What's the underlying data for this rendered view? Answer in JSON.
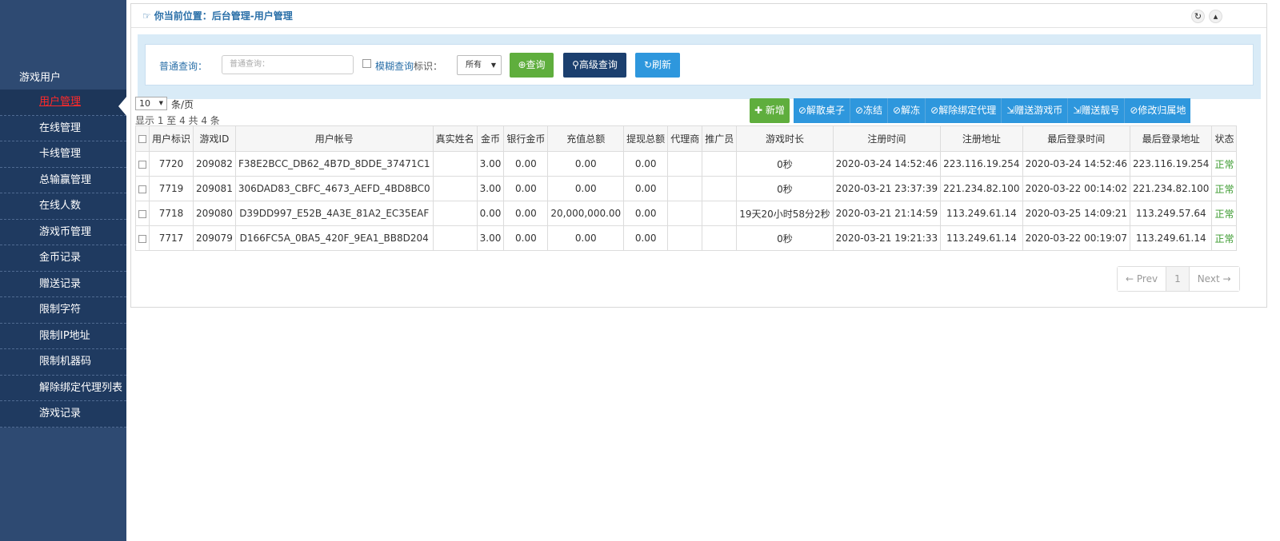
{
  "sidebar": {
    "group_title": "游戏用户",
    "items": [
      {
        "label": "用户管理",
        "active": true
      },
      {
        "label": "在线管理"
      },
      {
        "label": "卡线管理"
      },
      {
        "label": "总输赢管理"
      },
      {
        "label": "在线人数"
      },
      {
        "label": "游戏币管理"
      },
      {
        "label": "金币记录"
      },
      {
        "label": "赠送记录"
      },
      {
        "label": "限制字符"
      },
      {
        "label": "限制IP地址"
      },
      {
        "label": "限制机器码"
      },
      {
        "label": "解除绑定代理列表"
      },
      {
        "label": "游戏记录"
      }
    ]
  },
  "breadcrumb": "你当前位置：后台管理-用户管理",
  "search": {
    "label": "普通查询：",
    "placeholder": "普通查询：",
    "fuzzy_label": "模糊查询",
    "tag_label": "标识：",
    "tag_value": "所有",
    "query_btn": "查询",
    "advanced_btn": "高级查询",
    "refresh_btn": "刷新"
  },
  "pagination": {
    "per_page": "10",
    "per_page_suffix": "条/页",
    "showing": "显示 1 至 4 共 4 条",
    "prev": "← Prev",
    "page": "1",
    "next": "Next →"
  },
  "toolbar": {
    "add": "新增",
    "dismiss_table": "解散桌子",
    "freeze": "冻结",
    "unfreeze": "解冻",
    "unbind_agent": "解除绑定代理",
    "gift_coin": "赠送游戏币",
    "gift_number": "赠送靓号",
    "change_region": "修改归属地"
  },
  "table": {
    "headers": [
      "用户标识",
      "游戏ID",
      "用户帐号",
      "真实姓名",
      "金币",
      "银行金币",
      "充值总额",
      "提现总额",
      "代理商",
      "推广员",
      "游戏时长",
      "注册时间",
      "注册地址",
      "最后登录时间",
      "最后登录地址",
      "状态"
    ],
    "rows": [
      [
        "7720",
        "209082",
        "F38E2BCC_DB62_4B7D_8DDE_37471C1",
        "",
        "3.00",
        "0.00",
        "0.00",
        "0.00",
        "",
        "",
        "0秒",
        "2020-03-24 14:52:46",
        "223.116.19.254",
        "2020-03-24 14:52:46",
        "223.116.19.254",
        "正常"
      ],
      [
        "7719",
        "209081",
        "306DAD83_CBFC_4673_AEFD_4BD8BC0",
        "",
        "3.00",
        "0.00",
        "0.00",
        "0.00",
        "",
        "",
        "0秒",
        "2020-03-21 23:37:39",
        "221.234.82.100",
        "2020-03-22 00:14:02",
        "221.234.82.100",
        "正常"
      ],
      [
        "7718",
        "209080",
        "D39DD997_E52B_4A3E_81A2_EC35EAF",
        "",
        "0.00",
        "0.00",
        "20,000,000.00",
        "0.00",
        "",
        "",
        "19天20小时58分2秒",
        "2020-03-21 21:14:59",
        "113.249.61.14",
        "2020-03-25 14:09:21",
        "113.249.57.64",
        "正常"
      ],
      [
        "7717",
        "209079",
        "D166FC5A_0BA5_420F_9EA1_BB8D204",
        "",
        "3.00",
        "0.00",
        "0.00",
        "0.00",
        "",
        "",
        "0秒",
        "2020-03-21 19:21:33",
        "113.249.61.14",
        "2020-03-22 00:19:07",
        "113.249.61.14",
        "正常"
      ]
    ]
  },
  "colors": {
    "sidebar_bg": "#2e4a72",
    "active_item": "#ff2a2a",
    "btn_green": "#5fae3d",
    "btn_navy": "#1b3f6e",
    "btn_blue": "#2e97dd",
    "status_ok": "#3a9a2e"
  },
  "icons": {
    "breadcrumb": "hand-pointer-icon",
    "refresh": "refresh-icon",
    "collapse": "chevron-up-icon"
  }
}
